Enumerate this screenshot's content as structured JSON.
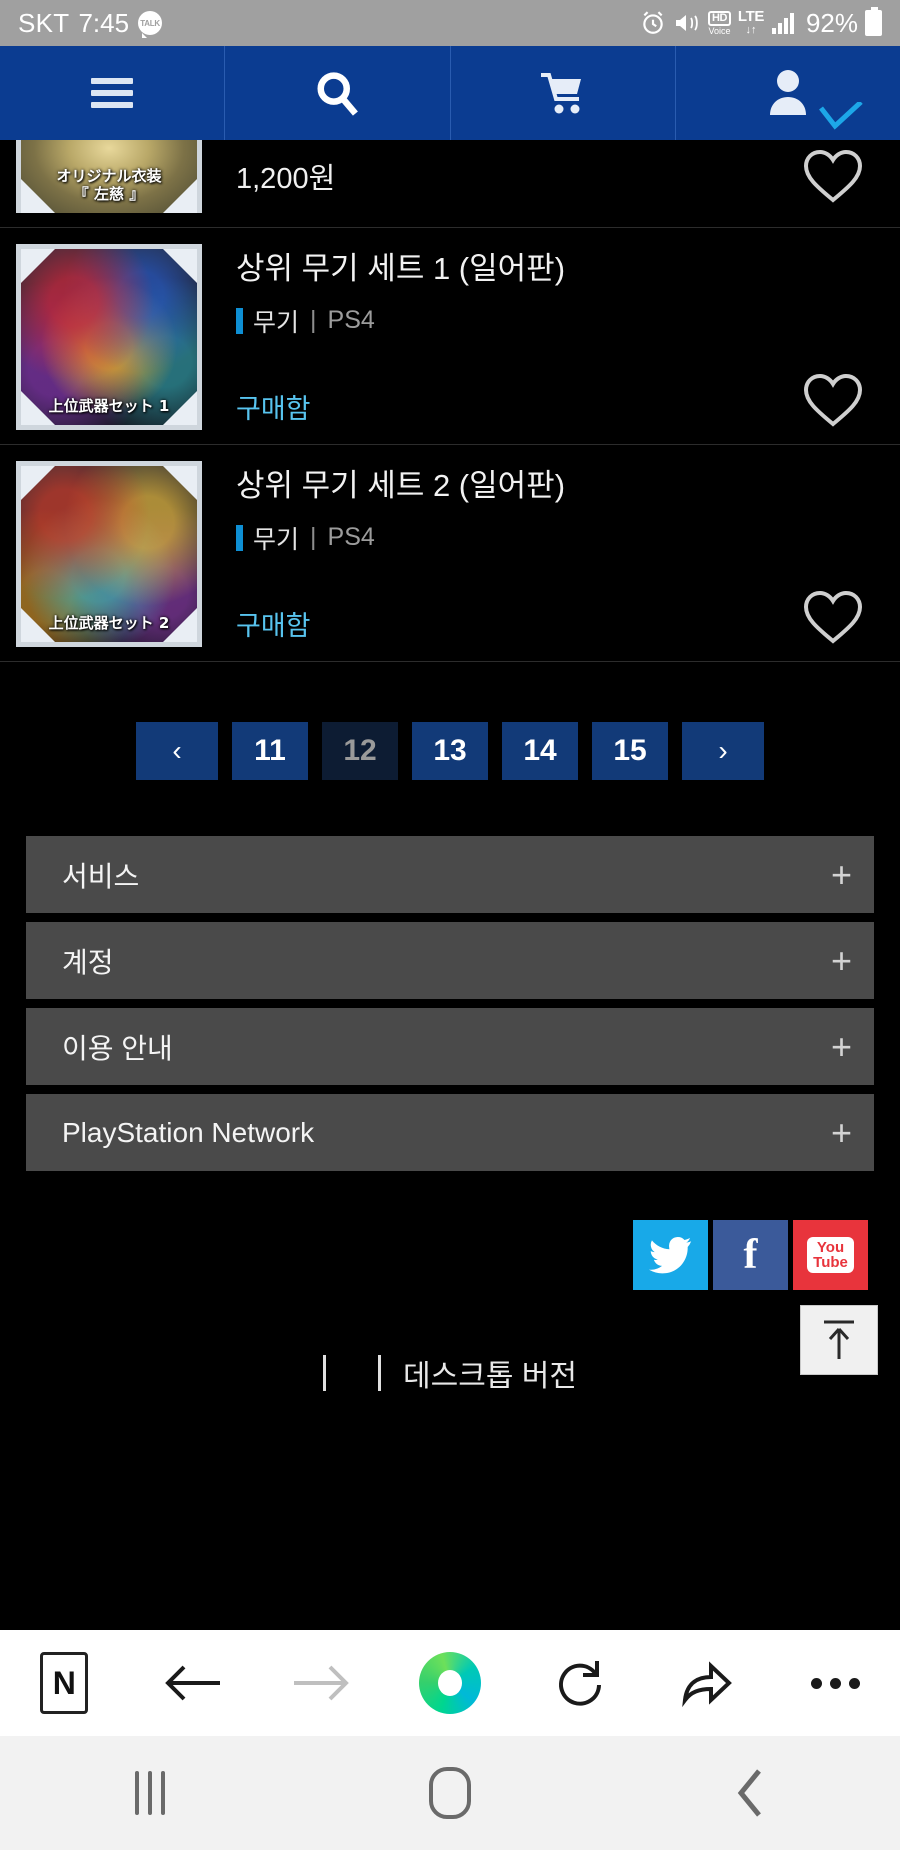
{
  "status_bar": {
    "carrier": "SKT",
    "time": "7:45",
    "talk_icon_label": "TALK",
    "alarm_icon": "alarm-clock-icon",
    "mute_icon": "volume-mute-icon",
    "hd_label": "HD",
    "voice_label": "Voice",
    "network_label": "LTE",
    "battery_percent": "92%",
    "bg_color": "#a0a0a0"
  },
  "nav_bar": {
    "bg_color": "#0b3c91",
    "items": [
      {
        "name": "menu",
        "icon": "hamburger-menu-icon"
      },
      {
        "name": "search",
        "icon": "search-icon"
      },
      {
        "name": "cart",
        "icon": "shopping-cart-icon"
      },
      {
        "name": "account",
        "icon": "user-account-icon",
        "badge": "checkmark"
      }
    ]
  },
  "products": [
    {
      "thumb_caption": "オリジナル衣装\n『 左慈 』",
      "thumb_style": "costume",
      "title": "",
      "category": "",
      "platform": "",
      "price": "1,200원",
      "status": "",
      "clipped": true
    },
    {
      "thumb_caption": "上位武器セット 1",
      "thumb_style": "weapons1",
      "title": "상위 무기 세트 1 (일어판)",
      "category": "무기",
      "platform": "PS4",
      "price": "",
      "status": "구매함",
      "clipped": false
    },
    {
      "thumb_caption": "上位武器セット 2",
      "thumb_style": "weapons2",
      "title": "상위 무기 세트 2 (일어판)",
      "category": "무기",
      "platform": "PS4",
      "price": "",
      "status": "구매함",
      "clipped": false
    }
  ],
  "pagination": {
    "prev_label": "‹",
    "next_label": "›",
    "pages": [
      "11",
      "12",
      "13",
      "14",
      "15"
    ],
    "current": "12",
    "active_bg": "#123a78",
    "current_bg": "#0d1c33"
  },
  "footer_accordion": {
    "expand_icon": "+",
    "items": [
      {
        "label": "서비스"
      },
      {
        "label": "계정"
      },
      {
        "label": "이용 안내"
      },
      {
        "label": "PlayStation Network"
      }
    ]
  },
  "social": [
    {
      "name": "twitter",
      "icon": "twitter-bird-icon",
      "color": "#18a9e8"
    },
    {
      "name": "facebook",
      "icon": "facebook-f-icon",
      "color": "#3b5a9a",
      "glyph": "f"
    },
    {
      "name": "youtube",
      "icon": "youtube-icon",
      "color": "#e8343c",
      "line1": "You",
      "line2": "Tube"
    }
  ],
  "scroll_top": {
    "icon": "arrow-up-to-line-icon"
  },
  "desktop_version": {
    "label": "데스크톱 버전",
    "checkbox": "unchecked"
  },
  "browser_toolbar": {
    "items": [
      {
        "name": "naver-home",
        "icon": "naver-n-icon",
        "glyph": "N"
      },
      {
        "name": "back",
        "icon": "arrow-left-icon",
        "enabled": true
      },
      {
        "name": "forward",
        "icon": "arrow-right-icon",
        "enabled": false
      },
      {
        "name": "whale-browser",
        "icon": "whale-logo-icon"
      },
      {
        "name": "reload",
        "icon": "refresh-icon"
      },
      {
        "name": "share",
        "icon": "share-arrow-icon"
      },
      {
        "name": "more",
        "icon": "more-horizontal-icon"
      }
    ]
  },
  "android_nav": {
    "items": [
      {
        "name": "recents",
        "icon": "recent-apps-icon"
      },
      {
        "name": "home",
        "icon": "home-pill-icon"
      },
      {
        "name": "back",
        "icon": "chevron-left-icon"
      }
    ]
  }
}
